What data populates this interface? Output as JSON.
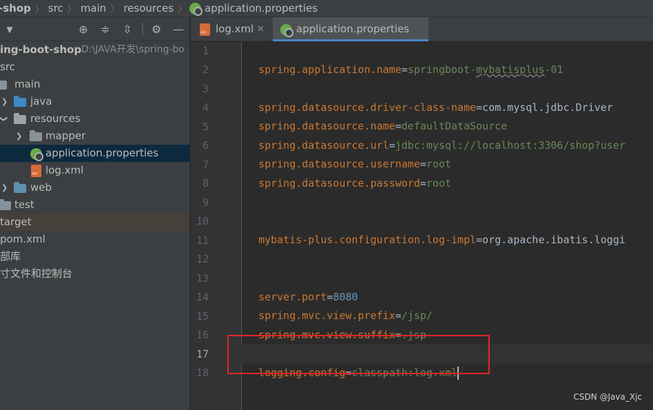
{
  "breadcrumb": {
    "project": "-shop",
    "parts": [
      "src",
      "main",
      "resources",
      "application.properties"
    ]
  },
  "project_tree": {
    "root_label": "ing-boot-shop",
    "root_path": "D:\\JAVA开发\\spring-bo",
    "items": [
      {
        "label": "src"
      },
      {
        "label": "main"
      },
      {
        "label": "java"
      },
      {
        "label": "resources"
      },
      {
        "label": "mapper"
      },
      {
        "label": "application.properties"
      },
      {
        "label": "log.xml"
      },
      {
        "label": "web"
      },
      {
        "label": "test"
      },
      {
        "label": "target"
      },
      {
        "label": "pom.xml"
      },
      {
        "label": "部库"
      },
      {
        "label": "寸文件和控制台"
      }
    ]
  },
  "tabs": [
    {
      "label": "log.xml",
      "icon": "xml-file-icon",
      "active": false
    },
    {
      "label": "application.properties",
      "icon": "spring-properties-icon",
      "active": true
    }
  ],
  "editor": {
    "current_line": 17,
    "lines": [
      {
        "n": "1",
        "key": "spring.application.name",
        "value_a": "springboot-",
        "value_b": "mybatisplus",
        "value_c": "-01"
      },
      {
        "n": "2"
      },
      {
        "n": "3",
        "key": "spring.datasource.driver-class-name",
        "value": "com.mysql.jdbc.Driver"
      },
      {
        "n": "4",
        "key": "spring.datasource.name",
        "value": "defaultDataSource"
      },
      {
        "n": "5",
        "key": "spring.datasource.url",
        "value": "jdbc:mysql://localhost:3306/shop?user"
      },
      {
        "n": "6",
        "key": "spring.datasource.username",
        "value": "root"
      },
      {
        "n": "7",
        "key": "spring.datasource.password",
        "value": "root"
      },
      {
        "n": "8"
      },
      {
        "n": "9"
      },
      {
        "n": "10",
        "key": "mybatis-plus.configuration.log-impl",
        "value": "org.apache.ibatis.loggi"
      },
      {
        "n": "11"
      },
      {
        "n": "12"
      },
      {
        "n": "13",
        "key": "server.port",
        "value": "8080"
      },
      {
        "n": "14",
        "key": "spring.mvc.view.prefix",
        "value": "/jsp/"
      },
      {
        "n": "15",
        "key": "spring.mvc.view.suffix",
        "value": ".jsp"
      },
      {
        "n": "16"
      },
      {
        "n": "17",
        "key": "logging.config",
        "value": "classpath:log.xml"
      },
      {
        "n": "18"
      }
    ],
    "eq": "="
  },
  "watermark": "CSDN @Java_Xjc",
  "colors": {
    "key": "#cc7832",
    "value": "#6a8759",
    "highlight": "#e0252b",
    "selection": "#0d293e"
  }
}
